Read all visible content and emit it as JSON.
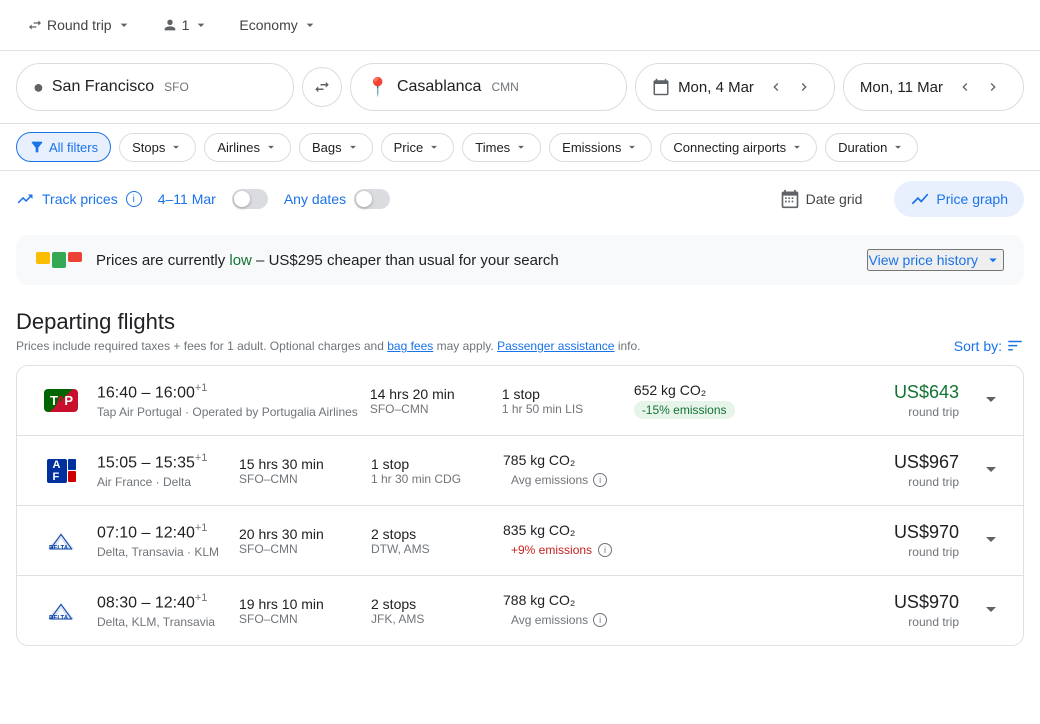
{
  "topbar": {
    "trip_type": "Round trip",
    "passengers": "1",
    "cabin": "Economy"
  },
  "search": {
    "origin_city": "San Francisco",
    "origin_code": "SFO",
    "destination_city": "Casablanca",
    "destination_code": "CMN",
    "date1": "Mon, 4 Mar",
    "date2": "Mon, 11 Mar"
  },
  "filters": {
    "all_filters": "All filters",
    "stops": "Stops",
    "airlines": "Airlines",
    "bags": "Bags",
    "price": "Price",
    "times": "Times",
    "emissions": "Emissions",
    "connecting": "Connecting airports",
    "duration": "Duration"
  },
  "track": {
    "label": "Track prices",
    "date_range": "4–11 Mar",
    "any_dates": "Any dates",
    "date_grid": "Date grid",
    "price_graph": "Price graph"
  },
  "price_banner": {
    "text_before": "Prices are currently ",
    "low_label": "low",
    "text_after": " – US$295 cheaper than usual for your search",
    "view_history": "View price history"
  },
  "departing": {
    "title": "Departing flights",
    "subtitle": "Prices include required taxes + fees for 1 adult. Optional charges and ",
    "bag_fees": "bag fees",
    "subtitle2": " may apply. ",
    "passenger_assist": "Passenger assistance",
    "subtitle3": " info.",
    "sort_label": "Sort by:"
  },
  "flights": [
    {
      "logo_type": "tap",
      "time": "16:40 – 16:00",
      "time_plus": "+1",
      "airline": "Tap Air Portugal · Operated by Portugalia Airlines",
      "duration": "14 hrs 20 min",
      "route": "SFO–CMN",
      "stops": "1 stop",
      "stop_detail": "1 hr 50 min LIS",
      "co2": "652 kg CO₂",
      "emission_badge": "-15% emissions",
      "emission_type": "low",
      "price": "US$643",
      "price_type": "round trip",
      "price_style": "cheap"
    },
    {
      "logo_type": "af",
      "time": "15:05 – 15:35",
      "time_plus": "+1",
      "airline": "Air France · Delta",
      "duration": "15 hrs 30 min",
      "route": "SFO–CMN",
      "stops": "1 stop",
      "stop_detail": "1 hr 30 min CDG",
      "co2": "785 kg CO₂",
      "emission_badge": "Avg emissions",
      "emission_type": "avg",
      "price": "US$967",
      "price_type": "round trip",
      "price_style": "normal"
    },
    {
      "logo_type": "delta",
      "time": "07:10 – 12:40",
      "time_plus": "+1",
      "airline": "Delta, Transavia · KLM",
      "duration": "20 hrs 30 min",
      "route": "SFO–CMN",
      "stops": "2 stops",
      "stop_detail": "DTW, AMS",
      "co2": "835 kg CO₂",
      "emission_badge": "+9% emissions",
      "emission_type": "high",
      "price": "US$970",
      "price_type": "round trip",
      "price_style": "normal"
    },
    {
      "logo_type": "delta",
      "time": "08:30 – 12:40",
      "time_plus": "+1",
      "airline": "Delta, KLM, Transavia",
      "duration": "19 hrs 10 min",
      "route": "SFO–CMN",
      "stops": "2 stops",
      "stop_detail": "JFK, AMS",
      "co2": "788 kg CO₂",
      "emission_badge": "Avg emissions",
      "emission_type": "avg",
      "price": "US$970",
      "price_type": "round trip",
      "price_style": "normal"
    }
  ]
}
